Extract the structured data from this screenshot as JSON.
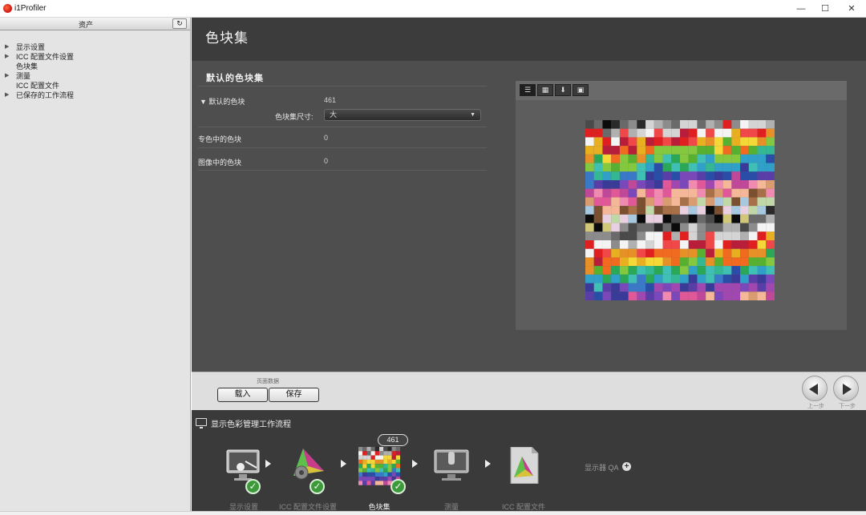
{
  "window": {
    "title": "i1Profiler",
    "minimize_icon": "minimize-icon",
    "maximize_icon": "maximize-icon",
    "close_icon": "close-icon"
  },
  "sidebar": {
    "header": "资产",
    "refresh_icon": "refresh-icon",
    "items": [
      {
        "label": "显示设置",
        "expandable": true
      },
      {
        "label": "ICC 配置文件设置",
        "expandable": true
      },
      {
        "label": "色块集",
        "expandable": false
      },
      {
        "label": "测量",
        "expandable": true
      },
      {
        "label": "ICC 配置文件",
        "expandable": false
      },
      {
        "label": "已保存的工作流程",
        "expandable": true
      }
    ]
  },
  "page": {
    "title": "色块集",
    "section_title": "默认的色块集",
    "default_patches": {
      "label": "默认的色块",
      "value": "461"
    },
    "patch_size": {
      "label": "色块集尺寸:",
      "selected": "大"
    },
    "spot_patches": {
      "label": "专色中的色块",
      "value": "0"
    },
    "image_patches": {
      "label": "图像中的色块",
      "value": "0"
    }
  },
  "preview_views": [
    "list-view-icon",
    "grid-view-icon",
    "eyedropper-icon",
    "image-view-icon"
  ],
  "palette": {
    "colors": [
      "#0b0b0b",
      "#2a2a2a",
      "#4a4a4a",
      "#6a6a6a",
      "#8c8c8c",
      "#b0b0b0",
      "#d4d4d4",
      "#f4f4f4",
      "#e02020",
      "#f04848",
      "#b81e3a",
      "#e8b020",
      "#f4d838",
      "#e89028",
      "#f06a20",
      "#58b030",
      "#84c840",
      "#2aa858",
      "#34b894",
      "#40c0b4",
      "#30a0c8",
      "#3a78c8",
      "#2a4ea8",
      "#3a3a98",
      "#5a3ea8",
      "#7a48b8",
      "#a048b0",
      "#c04898",
      "#e05898",
      "#f08ab0",
      "#f4b898",
      "#d89c70",
      "#a87048",
      "#7a5030",
      "#c0d8a8",
      "#a8c8e0",
      "#e8d0e0",
      "#d0c878"
    ]
  },
  "toolbar": {
    "caption": "页面数据",
    "load_label": "载入",
    "save_label": "保存",
    "prev_label": "上一步",
    "next_label": "下一步"
  },
  "workflow": {
    "title": "显示色彩管理工作流程",
    "patch_count": "461",
    "display_link": "显示器 QA",
    "steps": [
      {
        "label": "显示设置",
        "done": true
      },
      {
        "label": "ICC 配置文件设置",
        "done": true
      },
      {
        "label": "色块集",
        "done": true
      },
      {
        "label": "测量",
        "done": false
      },
      {
        "label": "ICC 配置文件",
        "done": false
      }
    ]
  }
}
